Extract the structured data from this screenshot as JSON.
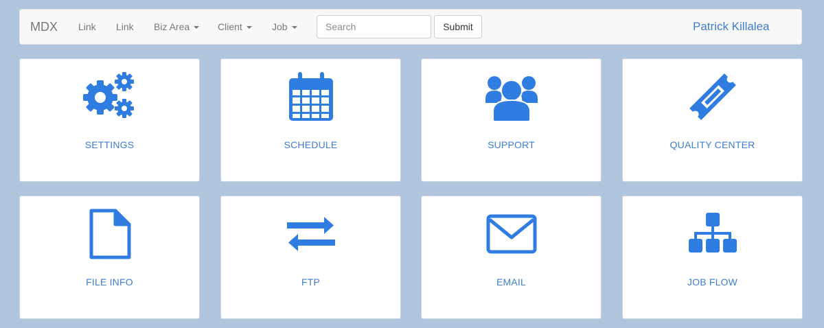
{
  "navbar": {
    "brand": "MDX",
    "links": [
      "Link",
      "Link"
    ],
    "dropdowns": [
      "Biz Area",
      "Client",
      "Job"
    ],
    "search_placeholder": "Search",
    "submit_label": "Submit",
    "user_name": "Patrick Killalea"
  },
  "colors": {
    "background": "#b0c4de",
    "accent": "#3e7dcc",
    "icon": "#2f7de1"
  },
  "tiles": [
    {
      "label": "SETTINGS",
      "icon": "gears-icon"
    },
    {
      "label": "SCHEDULE",
      "icon": "calendar-icon"
    },
    {
      "label": "SUPPORT",
      "icon": "users-icon"
    },
    {
      "label": "QUALITY CENTER",
      "icon": "ticket-icon"
    },
    {
      "label": "FILE INFO",
      "icon": "file-icon"
    },
    {
      "label": "FTP",
      "icon": "transfer-arrows-icon"
    },
    {
      "label": "EMAIL",
      "icon": "envelope-icon"
    },
    {
      "label": "JOB FLOW",
      "icon": "sitemap-icon"
    }
  ]
}
